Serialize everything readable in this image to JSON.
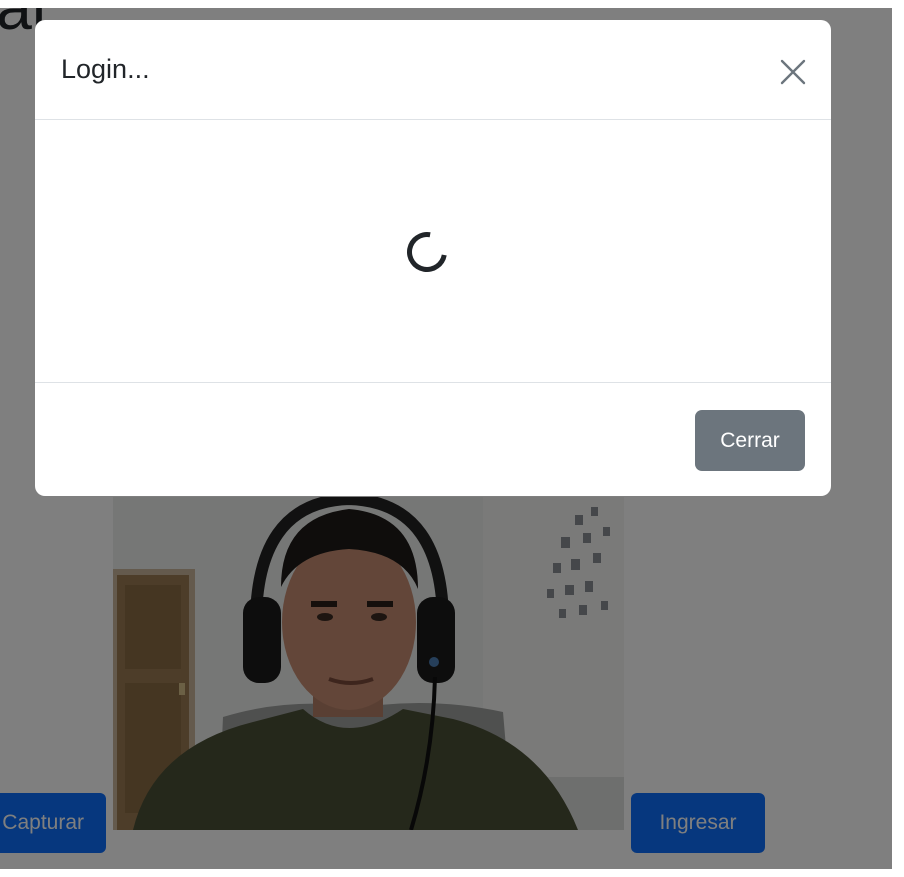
{
  "page": {
    "heading": "ial",
    "capture_button_label": "Capturar",
    "login_button_label": "Ingresar"
  },
  "modal": {
    "title": "Login...",
    "close_icon": "close-icon",
    "spinner_icon": "loading-spinner",
    "footer_close_label": "Cerrar"
  },
  "colors": {
    "primary": "#0d6efd",
    "secondary": "#6c757d",
    "backdrop": "rgba(0,0,0,0.5)"
  }
}
